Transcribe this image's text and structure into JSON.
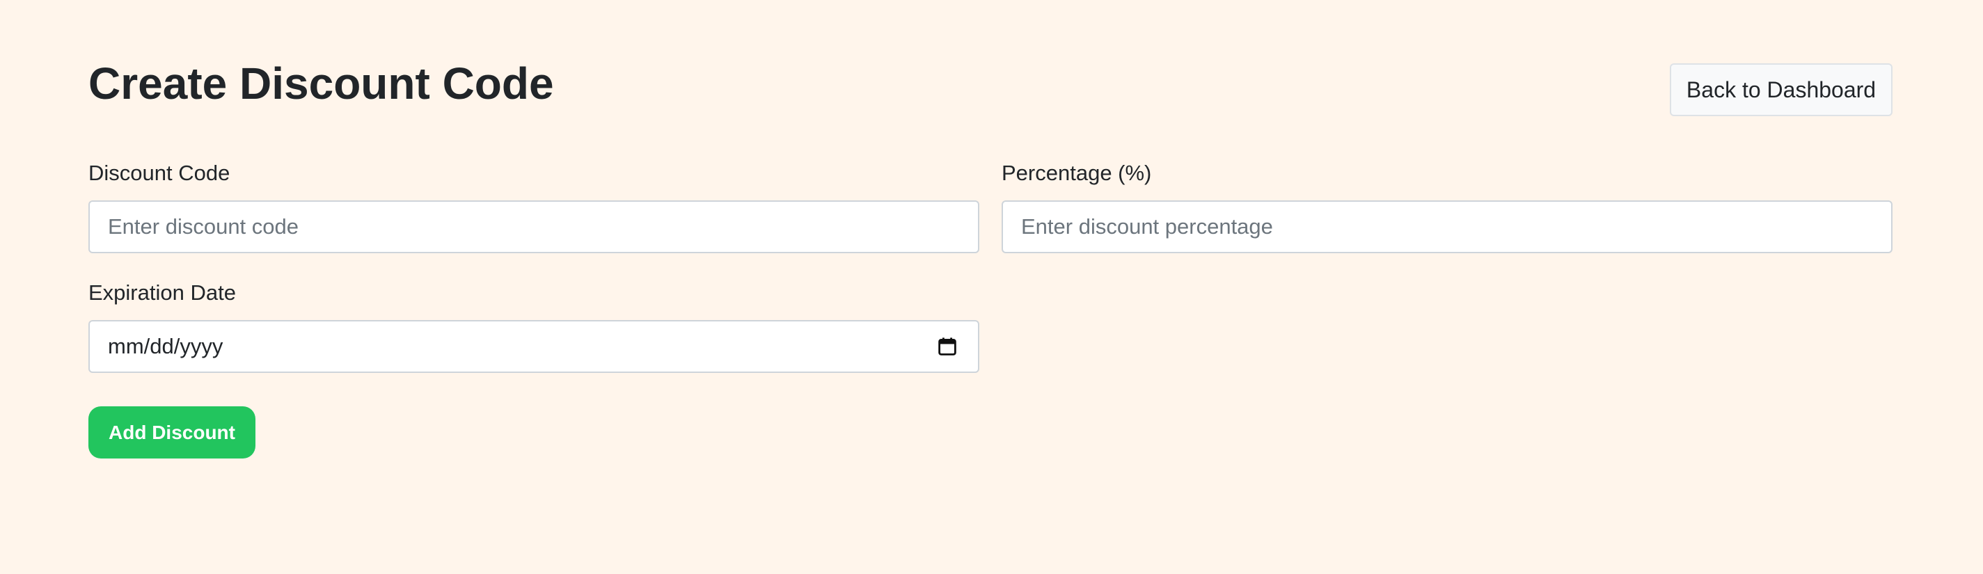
{
  "header": {
    "title": "Create Discount Code",
    "back_button_label": "Back to Dashboard"
  },
  "form": {
    "discount_code": {
      "label": "Discount Code",
      "placeholder": "Enter discount code",
      "value": ""
    },
    "percentage": {
      "label": "Percentage (%)",
      "placeholder": "Enter discount percentage",
      "value": ""
    },
    "expiration_date": {
      "label": "Expiration Date",
      "display_value": "mm/dd/yyyy",
      "icon": "calendar-icon"
    },
    "submit_label": "Add Discount"
  },
  "colors": {
    "background": "#fff5eb",
    "primary_action": "#22c55e",
    "secondary_button": "#f8f9fa",
    "input_border": "#ced4da"
  }
}
